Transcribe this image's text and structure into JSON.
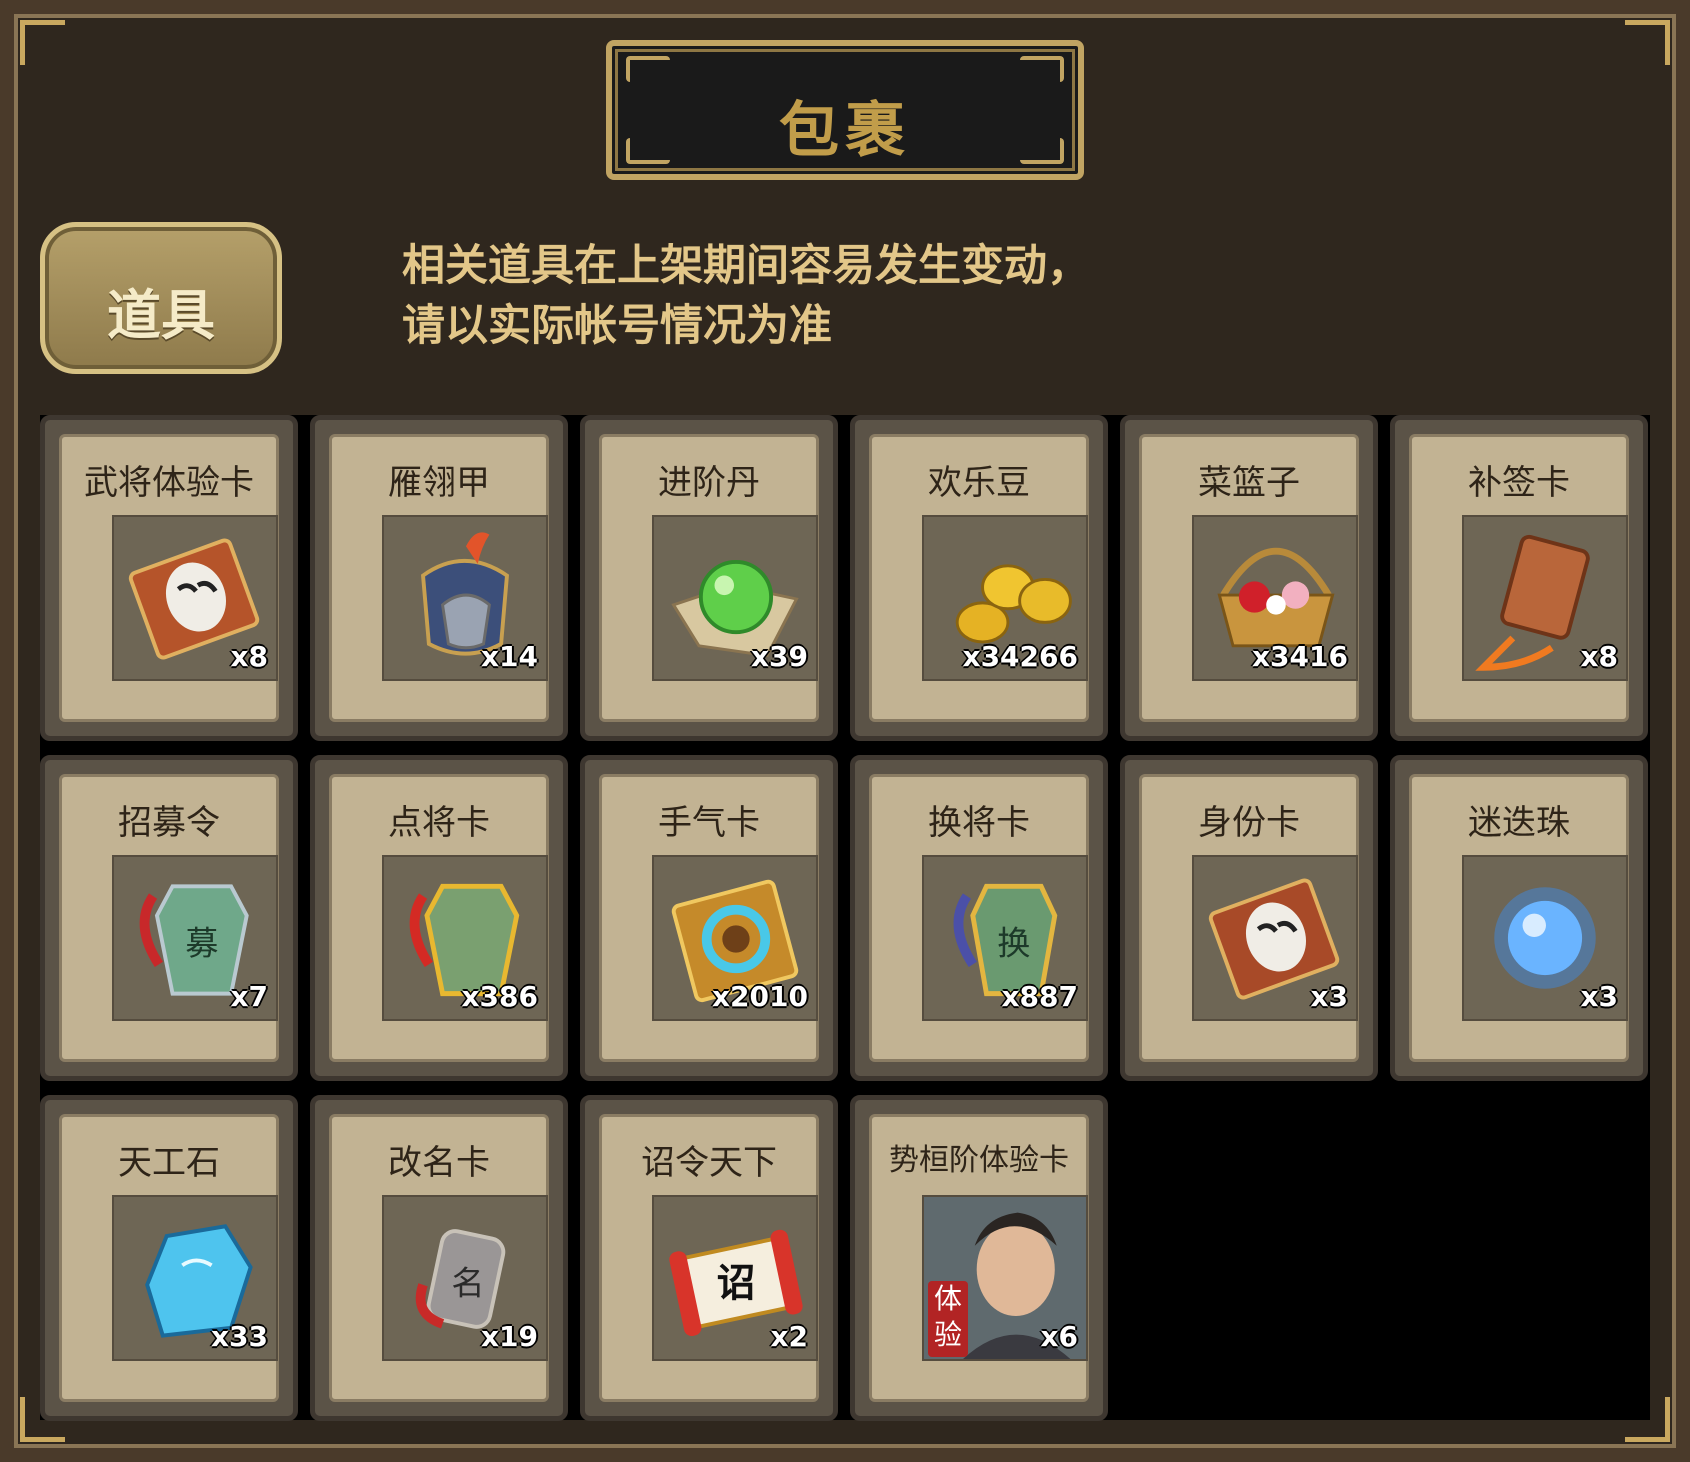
{
  "header": {
    "title": "包裹"
  },
  "tabs": [
    {
      "label": "道具"
    }
  ],
  "notice": {
    "line1": "相关道具在上架期间容易发生变动，",
    "line2": "请以实际帐号情况为准"
  },
  "items": [
    {
      "name": "武将体验卡",
      "count": "x8",
      "icon": "opera-mask-card-icon"
    },
    {
      "name": "雁翎甲",
      "count": "x14",
      "icon": "armor-icon"
    },
    {
      "name": "进阶丹",
      "count": "x39",
      "icon": "green-pill-icon"
    },
    {
      "name": "欢乐豆",
      "count": "x34266",
      "icon": "gold-beans-icon"
    },
    {
      "name": "菜篮子",
      "count": "x3416",
      "icon": "flower-basket-icon"
    },
    {
      "name": "补签卡",
      "count": "x8",
      "icon": "copper-token-icon"
    },
    {
      "name": "招募令",
      "count": "x7",
      "icon": "recruit-token-icon"
    },
    {
      "name": "点将卡",
      "count": "x386",
      "icon": "select-general-token-icon"
    },
    {
      "name": "手气卡",
      "count": "x2010",
      "icon": "refresh-card-icon"
    },
    {
      "name": "换将卡",
      "count": "x887",
      "icon": "swap-general-token-icon"
    },
    {
      "name": "身份卡",
      "count": "x3",
      "icon": "identity-mask-card-icon"
    },
    {
      "name": "迷迭珠",
      "count": "x3",
      "icon": "blue-orb-icon"
    },
    {
      "name": "天工石",
      "count": "x33",
      "icon": "blue-crystal-icon"
    },
    {
      "name": "改名卡",
      "count": "x19",
      "icon": "name-token-icon"
    },
    {
      "name": "诏令天下",
      "count": "x2",
      "icon": "edict-scroll-icon"
    },
    {
      "name": "势桓阶体验卡",
      "count": "x6",
      "icon": "general-portrait-icon",
      "badge": "体验"
    }
  ],
  "colors": {
    "accent_gold": "#c19d4a",
    "notice_text": "#e3c789",
    "panel_bg": "#2f271e"
  }
}
